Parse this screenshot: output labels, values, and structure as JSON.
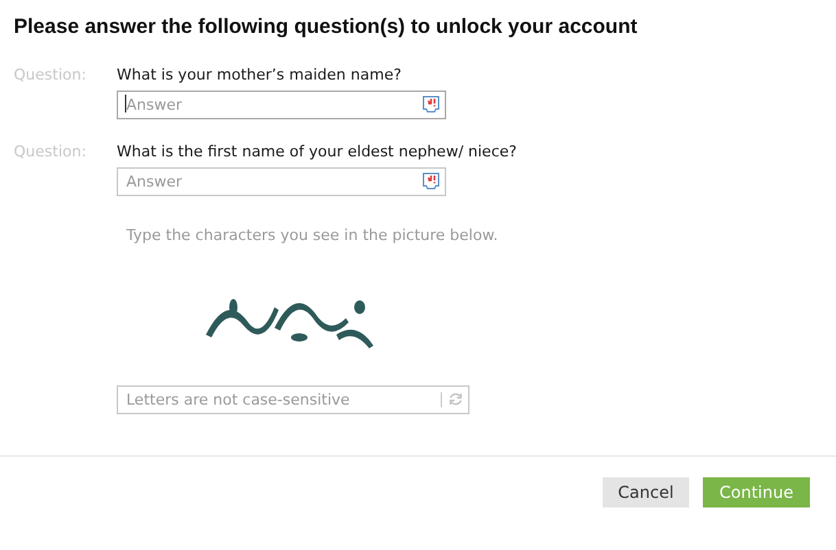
{
  "title": "Please answer the following question(s) to unlock your account",
  "questions": [
    {
      "label": "Question:",
      "text": "What is your mother’s maiden name?",
      "placeholder": "Answer",
      "focused": true
    },
    {
      "label": "Question:",
      "text": "What is the first name of your eldest nephew/ niece?",
      "placeholder": "Answer",
      "focused": false
    }
  ],
  "captcha": {
    "hint": "Type the characters you see in the picture below.",
    "placeholder": "Letters are not case-sensitive"
  },
  "buttons": [
    {
      "label": "Cancel",
      "kind": "secondary"
    },
    {
      "label": "Continue",
      "kind": "primary"
    }
  ]
}
